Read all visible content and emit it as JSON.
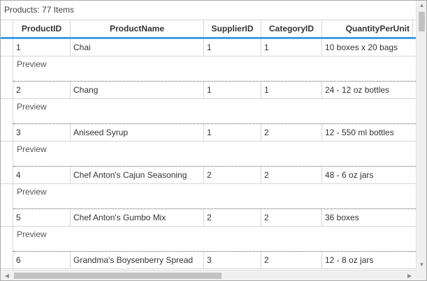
{
  "grid": {
    "group_panel_text": "Products: 77 Items",
    "columns": [
      "ProductID",
      "ProductName",
      "SupplierID",
      "CategoryID",
      "QuantityPerUnit"
    ],
    "preview_label": "Preview",
    "rows": [
      {
        "ProductID": "1",
        "ProductName": "Chai",
        "SupplierID": "1",
        "CategoryID": "1",
        "QuantityPerUnit": "10 boxes x 20 bags"
      },
      {
        "ProductID": "2",
        "ProductName": "Chang",
        "SupplierID": "1",
        "CategoryID": "1",
        "QuantityPerUnit": "24 - 12 oz bottles"
      },
      {
        "ProductID": "3",
        "ProductName": "Aniseed Syrup",
        "SupplierID": "1",
        "CategoryID": "2",
        "QuantityPerUnit": "12 - 550 ml bottles"
      },
      {
        "ProductID": "4",
        "ProductName": "Chef Anton's Cajun Seasoning",
        "SupplierID": "2",
        "CategoryID": "2",
        "QuantityPerUnit": "48 - 6 oz jars"
      },
      {
        "ProductID": "5",
        "ProductName": "Chef Anton's Gumbo Mix",
        "SupplierID": "2",
        "CategoryID": "2",
        "QuantityPerUnit": "36 boxes"
      },
      {
        "ProductID": "6",
        "ProductName": "Grandma's Boysenberry Spread",
        "SupplierID": "3",
        "CategoryID": "2",
        "QuantityPerUnit": "12 - 8 oz jars"
      }
    ]
  },
  "scrollbars": {
    "vertical": {
      "up_icon": "triangle-up-icon",
      "down_icon": "triangle-down-icon",
      "position_fraction": 0.0
    },
    "horizontal": {
      "left_icon": "triangle-left-icon",
      "right_icon": "triangle-right-icon",
      "position_fraction": 0.0
    }
  },
  "colors": {
    "header_accent": "#3ea0de",
    "border": "#d6d6d6",
    "scroll_thumb": "#c2c2c2"
  }
}
